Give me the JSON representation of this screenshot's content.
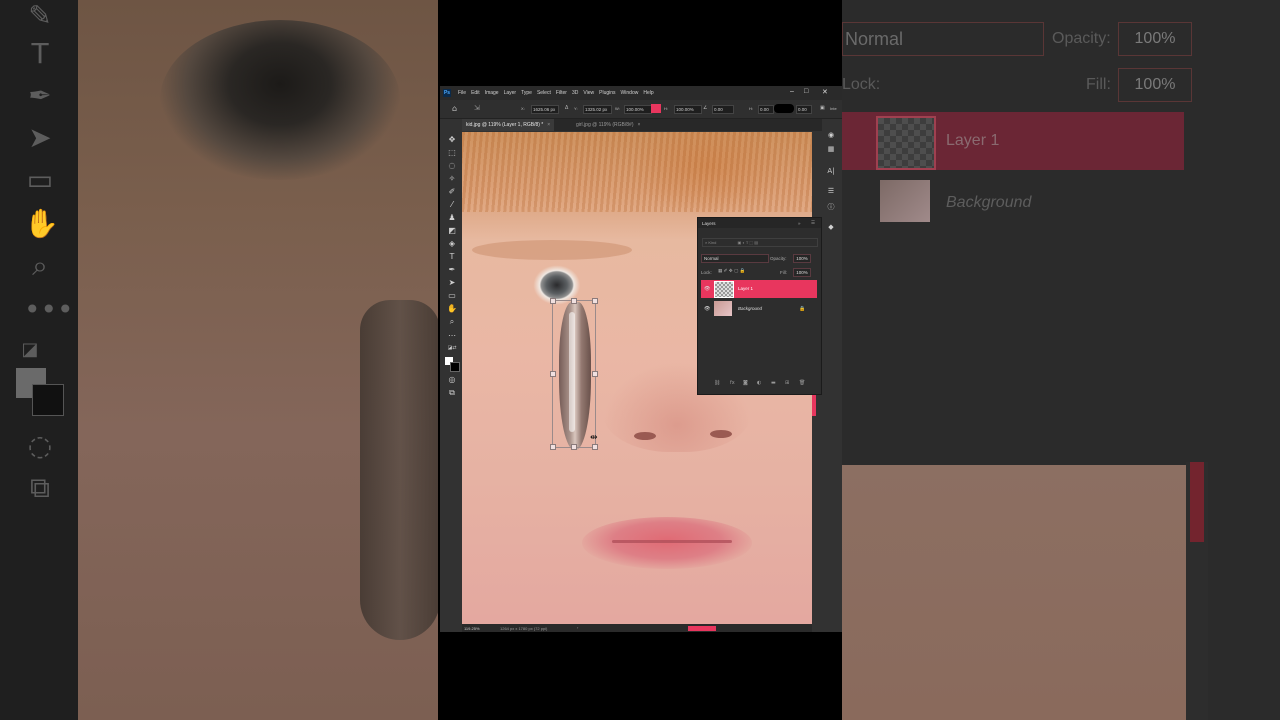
{
  "app": {
    "logo": "Ps",
    "menu": [
      "File",
      "Edit",
      "Image",
      "Layer",
      "Type",
      "Select",
      "Filter",
      "3D",
      "View",
      "Plugins",
      "Window",
      "Help"
    ],
    "window_controls": [
      "‒",
      "□",
      "✕"
    ]
  },
  "options_bar": {
    "x_label": "X:",
    "x_value": "1625.06 px",
    "y_label": "Y:",
    "y_value": "1325.02 px",
    "w_label": "W:",
    "w_value": "100.00%",
    "h_label": "H:",
    "h_value": "100.00%",
    "angle_value": "0.00",
    "h_skew_label": "H:",
    "h_skew_value": "0.00",
    "v_skew_value": "0.00",
    "interp_label": "Inte"
  },
  "tabs": [
    {
      "label": "kid.jpg @ 119% (Layer 1, RGB/8) *",
      "active": true
    },
    {
      "label": "girl.jpg @ 119% (RGB/8#)",
      "active": false
    }
  ],
  "status_bar": {
    "zoom": "119.25%",
    "doc_info": "1264 px x 1780 px (72 ppi)",
    "arrow": "›"
  },
  "layers_panel": {
    "title": "Layers",
    "filter_label": "Kind",
    "blend_mode": "Normal",
    "opacity_label": "Opacity:",
    "opacity_value": "100%",
    "lock_label": "Lock:",
    "fill_label": "Fill:",
    "fill_value": "100%",
    "layers": [
      {
        "name": "Layer 1",
        "selected": true,
        "visible": true
      },
      {
        "name": "Background",
        "selected": false,
        "visible": true,
        "locked": true
      }
    ]
  },
  "background_zoom": {
    "blend_mode": "Normal",
    "opacity_label": "Opacity:",
    "opacity_value": "100%",
    "lock_label": "Lock:",
    "fill_label": "Fill:",
    "fill_value": "100%",
    "layer1_name": "Layer 1",
    "background_name": "Background"
  },
  "colors": {
    "accent": "#e8365e",
    "panel": "#2d2d2d",
    "app_bg": "#323232"
  }
}
